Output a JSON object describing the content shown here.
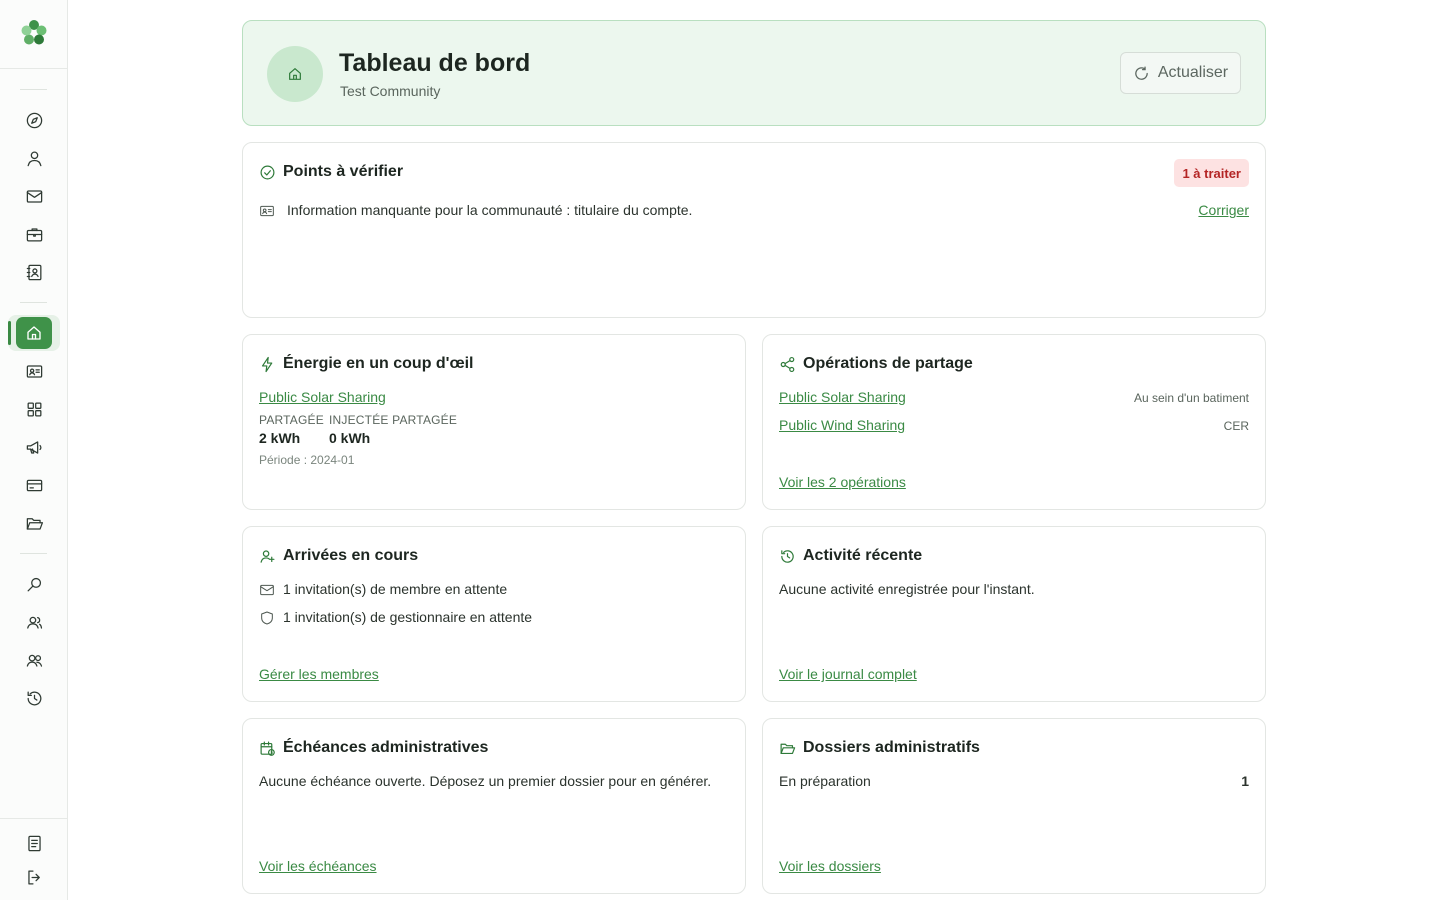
{
  "header": {
    "title": "Tableau de bord",
    "subtitle": "Test Community",
    "refresh_label": "Actualiser"
  },
  "checks": {
    "title": "Points à vérifier",
    "badge": "1 à traiter",
    "items": [
      {
        "text": "Information manquante pour la communauté : titulaire du compte.",
        "action": "Corriger"
      }
    ]
  },
  "energy": {
    "title": "Énergie en un coup d'œil",
    "operation": "Public Solar Sharing",
    "shared_label": "PARTAGÉE",
    "shared_value": "2 kWh",
    "injected_label": "INJECTÉE PARTAGÉE",
    "injected_value": "0 kWh",
    "period": "Période : 2024-01"
  },
  "operations": {
    "title": "Opérations de partage",
    "items": [
      {
        "name": "Public Solar Sharing",
        "type": "Au sein d'un batiment"
      },
      {
        "name": "Public Wind Sharing",
        "type": "CER"
      }
    ],
    "link": "Voir les 2 opérations"
  },
  "arrivals": {
    "title": "Arrivées en cours",
    "items": [
      "1 invitation(s) de membre en attente",
      "1 invitation(s) de gestionnaire en attente"
    ],
    "link": "Gérer les membres"
  },
  "activity": {
    "title": "Activité récente",
    "empty": "Aucune activité enregistrée pour l'instant.",
    "link": "Voir le journal complet"
  },
  "deadlines": {
    "title": "Échéances administratives",
    "empty": "Aucune échéance ouverte. Déposez un premier dossier pour en générer.",
    "link": "Voir les échéances"
  },
  "files": {
    "title": "Dossiers administratifs",
    "rows": [
      {
        "label": "En préparation",
        "count": "1"
      }
    ],
    "link": "Voir les dossiers"
  },
  "theme": {
    "accent": "#3a8a44",
    "header_bg": "#ecf7ee",
    "badge_bg": "#fde2e2",
    "badge_text": "#b42525"
  },
  "sidebar_icons": [
    "compass-icon",
    "user-icon",
    "mail-icon",
    "briefcase-icon",
    "contact-book-icon",
    "home-icon",
    "id-card-icon",
    "grid-icon",
    "megaphone-icon",
    "credit-card-icon",
    "folder-open-icon",
    "search-icon",
    "users-icon",
    "team-icon",
    "history-icon",
    "notebook-icon",
    "logout-icon"
  ]
}
